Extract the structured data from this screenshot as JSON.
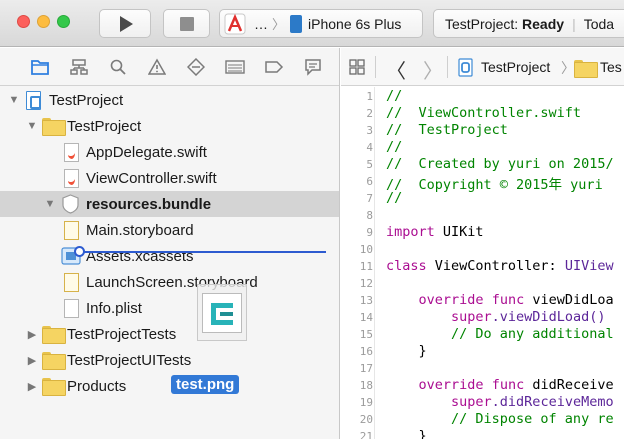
{
  "toolbar": {
    "scheme_app": "…",
    "scheme_device": "iPhone 6s Plus",
    "status_project": "TestProject:",
    "status_state": "Ready",
    "status_extra": "Toda"
  },
  "navigator": {
    "rows": [
      {
        "label": "TestProject",
        "kind": "project",
        "disclosure": "▼"
      },
      {
        "label": "TestProject",
        "kind": "folder",
        "disclosure": "▼"
      },
      {
        "label": "AppDelegate.swift",
        "kind": "swift",
        "disclosure": ""
      },
      {
        "label": "ViewController.swift",
        "kind": "swift",
        "disclosure": ""
      },
      {
        "label": "resources.bundle",
        "kind": "bundle",
        "disclosure": "▼"
      },
      {
        "label": "Main.storyboard",
        "kind": "storyboard",
        "disclosure": ""
      },
      {
        "label": "Assets.xcassets",
        "kind": "assets",
        "disclosure": ""
      },
      {
        "label": "LaunchScreen.storyboard",
        "kind": "storyboard",
        "disclosure": ""
      },
      {
        "label": "Info.plist",
        "kind": "plist",
        "disclosure": ""
      },
      {
        "label": "TestProjectTests",
        "kind": "folder",
        "disclosure": "▶"
      },
      {
        "label": "TestProjectUITests",
        "kind": "folder",
        "disclosure": "▶"
      },
      {
        "label": "Products",
        "kind": "folder",
        "disclosure": "▶"
      }
    ],
    "drag_label": "test.png"
  },
  "editor": {
    "jump_project": "TestProject",
    "jump_folder": "Tes",
    "lines": [
      {
        "n": "1",
        "text": "//",
        "cls": "c-comment"
      },
      {
        "n": "2",
        "text": "//  ViewController.swift",
        "cls": "c-comment"
      },
      {
        "n": "3",
        "text": "//  TestProject",
        "cls": "c-comment"
      },
      {
        "n": "4",
        "text": "//",
        "cls": "c-comment"
      },
      {
        "n": "5",
        "text": "//  Created by yuri on 2015/",
        "cls": "c-comment"
      },
      {
        "n": "6",
        "text": "//  Copyright © 2015年 yuri",
        "cls": "c-comment"
      },
      {
        "n": "7",
        "text": "//",
        "cls": "c-comment"
      },
      {
        "n": "8",
        "text": "",
        "cls": "c-plain"
      },
      {
        "n": "9",
        "text": "import UIKit",
        "cls": "c-import"
      },
      {
        "n": "10",
        "text": "",
        "cls": "c-plain"
      },
      {
        "n": "11",
        "text": "class ViewController: UIView",
        "cls": "c-classdecl"
      },
      {
        "n": "12",
        "text": "",
        "cls": "c-plain"
      },
      {
        "n": "13",
        "text": "    override func viewDidLoa",
        "cls": "c-func"
      },
      {
        "n": "14",
        "text": "        super.viewDidLoad()",
        "cls": "c-super"
      },
      {
        "n": "15",
        "text": "        // Do any additional",
        "cls": "c-comment"
      },
      {
        "n": "16",
        "text": "    }",
        "cls": "c-plain"
      },
      {
        "n": "17",
        "text": "",
        "cls": "c-plain"
      },
      {
        "n": "18",
        "text": "    override func didReceive",
        "cls": "c-func"
      },
      {
        "n": "19",
        "text": "        super.didReceiveMemo",
        "cls": "c-super"
      },
      {
        "n": "20",
        "text": "        // Dispose of any re",
        "cls": "c-comment"
      },
      {
        "n": "21",
        "text": "    }",
        "cls": "c-plain"
      }
    ]
  },
  "colors": {
    "comment": "#008400",
    "keyword": "#aa0d91",
    "selection": "#d4d4d4",
    "drop_indicator": "#2d5bd0",
    "drag_label_bg": "#3279d6"
  }
}
